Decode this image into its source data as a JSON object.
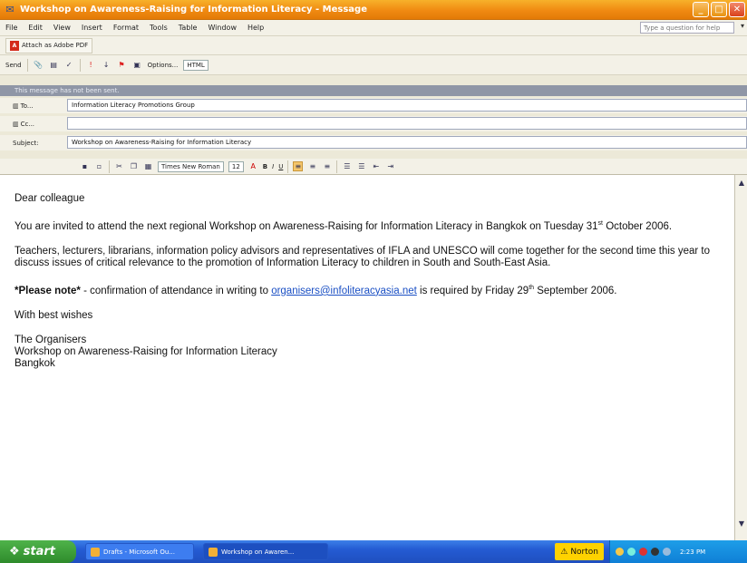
{
  "window": {
    "title": "Workshop on Awareness-Raising for Information Literacy - Message",
    "min": "_",
    "max": "□",
    "close": "✕"
  },
  "menu": {
    "items": [
      "File",
      "Edit",
      "View",
      "Insert",
      "Format",
      "Tools",
      "Table",
      "Window",
      "Help"
    ],
    "help_placeholder": "Type a question for help"
  },
  "toolbar": {
    "attach_pdf": "Attach as Adobe PDF",
    "send": "Send",
    "options": "Options...",
    "format": "HTML"
  },
  "message": {
    "info": "This message has not been sent.",
    "to_label": "To...",
    "to_value": "Information Literacy Promotions Group",
    "cc_label": "Cc...",
    "cc_value": "",
    "subject_label": "Subject:",
    "subject_value": "Workshop on Awareness-Raising for Information Literacy"
  },
  "format_toolbar": {
    "font": "Times New Roman",
    "size": "12",
    "bold": "B",
    "italic": "I",
    "underline": "U"
  },
  "body": {
    "greeting": "Dear colleague",
    "p1_a": "You are invited to attend the next regional Workshop on Awareness-Raising for Information Literacy in Bangkok on Tuesday 31",
    "p1_sup": "st",
    "p1_b": " October 2006.",
    "p2": "Teachers, lecturers, librarians, information policy advisors and representatives of IFLA and UNESCO will come together for the second time this year to discuss issues of critical relevance to the promotion of Information Literacy to children in South and South-East Asia.",
    "note_bold": "*Please note*",
    "note_a": " - confirmation of attendance in writing to ",
    "email": "organisers@infoliteracyasia.net",
    "note_b": " is required by Friday 29",
    "note_sup": "th",
    "note_c": " September 2006.",
    "closing": "With best wishes",
    "sig1": "The Organisers",
    "sig2": "Workshop on Awareness-Raising for Information Literacy",
    "sig3": "Bangkok"
  },
  "taskbar": {
    "start": "start",
    "task1": "Drafts - Microsoft Ou...",
    "task2": "Workshop on Awaren...",
    "norton": "Norton",
    "clock": "2:23 PM"
  }
}
